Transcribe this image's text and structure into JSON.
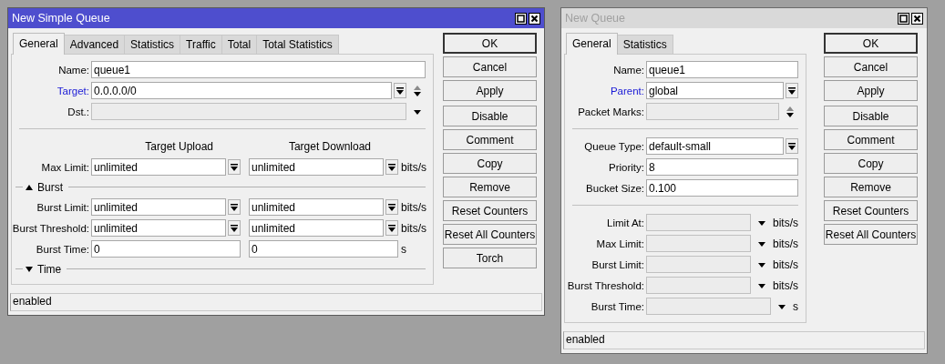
{
  "windows": [
    {
      "title": "New Simple Queue",
      "active": true,
      "tabs": [
        {
          "label": "General",
          "selected": true
        },
        {
          "label": "Advanced",
          "selected": false
        },
        {
          "label": "Statistics",
          "selected": false
        },
        {
          "label": "Traffic",
          "selected": false
        },
        {
          "label": "Total",
          "selected": false
        },
        {
          "label": "Total Statistics",
          "selected": false
        }
      ],
      "rows": [
        {
          "kind": "field",
          "label": "Name:",
          "link": false,
          "inputs": [
            {
              "value": "queue1",
              "disabled": false,
              "dropdown": false
            }
          ]
        },
        {
          "kind": "field",
          "label": "Target:",
          "link": true,
          "inputs": [
            {
              "value": "0.0.0.0/0",
              "disabled": false,
              "dropdown": true,
              "up_down_arrows": true
            }
          ]
        },
        {
          "kind": "field",
          "label": "Dst.:",
          "link": false,
          "inputs": [
            {
              "disabled": true,
              "dropdown": false,
              "down_arrow": true
            }
          ]
        },
        {
          "kind": "separator"
        },
        {
          "kind": "header",
          "columns": [
            "Target Upload",
            "Target Download"
          ]
        },
        {
          "kind": "field",
          "label": "Max Limit:",
          "link": false,
          "inputs": [
            {
              "value": "unlimited",
              "disabled": false,
              "dropdown": true
            },
            {
              "value": "unlimited",
              "disabled": false,
              "dropdown": true
            }
          ],
          "unit": "bits/s"
        },
        {
          "kind": "section",
          "label": "Burst",
          "expanded": true
        },
        {
          "kind": "field",
          "label": "Burst Limit:",
          "link": false,
          "inputs": [
            {
              "value": "unlimited",
              "disabled": false,
              "dropdown": true
            },
            {
              "value": "unlimited",
              "disabled": false,
              "dropdown": true
            }
          ],
          "unit": "bits/s"
        },
        {
          "kind": "field",
          "label": "Burst Threshold:",
          "link": false,
          "inputs": [
            {
              "value": "unlimited",
              "disabled": false,
              "dropdown": true
            },
            {
              "value": "unlimited",
              "disabled": false,
              "dropdown": true
            }
          ],
          "unit": "bits/s"
        },
        {
          "kind": "field",
          "label": "Burst Time:",
          "link": false,
          "inputs": [
            {
              "value": "0",
              "disabled": false,
              "dropdown": false
            },
            {
              "value": "0",
              "disabled": false,
              "dropdown": false
            }
          ],
          "unit": "s"
        },
        {
          "kind": "section",
          "label": "Time",
          "expanded": false
        }
      ],
      "button_groups": [
        [
          {
            "label": "OK",
            "default": true
          },
          {
            "label": "Cancel",
            "default": false
          },
          {
            "label": "Apply",
            "default": false
          }
        ],
        [
          {
            "label": "Disable",
            "default": false
          },
          {
            "label": "Comment",
            "default": false
          },
          {
            "label": "Copy",
            "default": false
          },
          {
            "label": "Remove",
            "default": false
          },
          {
            "label": "Reset Counters",
            "default": false
          },
          {
            "label": "Reset All Counters",
            "default": false
          },
          {
            "label": "Torch",
            "default": false
          }
        ]
      ],
      "status": "enabled"
    },
    {
      "title": "New Queue",
      "active": false,
      "tabs": [
        {
          "label": "General",
          "selected": true
        },
        {
          "label": "Statistics",
          "selected": false
        }
      ],
      "rows": [
        {
          "kind": "field",
          "label": "Name:",
          "link": false,
          "inputs": [
            {
              "value": "queue1",
              "disabled": false,
              "dropdown": false
            }
          ]
        },
        {
          "kind": "field",
          "label": "Parent:",
          "link": true,
          "inputs": [
            {
              "value": "global",
              "disabled": false,
              "dropdown": true
            }
          ]
        },
        {
          "kind": "field",
          "label": "Packet Marks:",
          "link": false,
          "inputs": [
            {
              "disabled": true,
              "dropdown": false,
              "up_down_arrows": true
            }
          ]
        },
        {
          "kind": "separator"
        },
        {
          "kind": "field",
          "label": "Queue Type:",
          "link": false,
          "inputs": [
            {
              "value": "default-small",
              "disabled": false,
              "dropdown": true
            }
          ]
        },
        {
          "kind": "field",
          "label": "Priority:",
          "link": false,
          "inputs": [
            {
              "value": "8",
              "disabled": false,
              "dropdown": false
            }
          ]
        },
        {
          "kind": "field",
          "label": "Bucket Size:",
          "link": false,
          "inputs": [
            {
              "value": "0.100",
              "disabled": false,
              "dropdown": false
            }
          ]
        },
        {
          "kind": "separator"
        },
        {
          "kind": "field",
          "label": "Limit At:",
          "link": false,
          "inputs": [
            {
              "disabled": true,
              "dropdown": false,
              "down_arrow": true
            }
          ],
          "unit": "bits/s"
        },
        {
          "kind": "field",
          "label": "Max Limit:",
          "link": false,
          "inputs": [
            {
              "disabled": true,
              "dropdown": false,
              "down_arrow": true
            }
          ],
          "unit": "bits/s"
        },
        {
          "kind": "field",
          "label": "Burst Limit:",
          "link": false,
          "inputs": [
            {
              "disabled": true,
              "dropdown": false,
              "down_arrow": true
            }
          ],
          "unit": "bits/s"
        },
        {
          "kind": "field",
          "label": "Burst Threshold:",
          "link": false,
          "inputs": [
            {
              "disabled": true,
              "dropdown": false,
              "down_arrow": true
            }
          ],
          "unit": "bits/s"
        },
        {
          "kind": "field",
          "label": "Burst Time:",
          "link": false,
          "inputs": [
            {
              "disabled": true,
              "dropdown": false,
              "down_arrow": true
            }
          ],
          "unit": "s"
        }
      ],
      "button_groups": [
        [
          {
            "label": "OK",
            "default": true
          },
          {
            "label": "Cancel",
            "default": false
          },
          {
            "label": "Apply",
            "default": false
          }
        ],
        [
          {
            "label": "Disable",
            "default": false
          },
          {
            "label": "Comment",
            "default": false
          },
          {
            "label": "Copy",
            "default": false
          },
          {
            "label": "Remove",
            "default": false
          },
          {
            "label": "Reset Counters",
            "default": false
          },
          {
            "label": "Reset All Counters",
            "default": false
          }
        ]
      ],
      "status": "enabled"
    }
  ]
}
